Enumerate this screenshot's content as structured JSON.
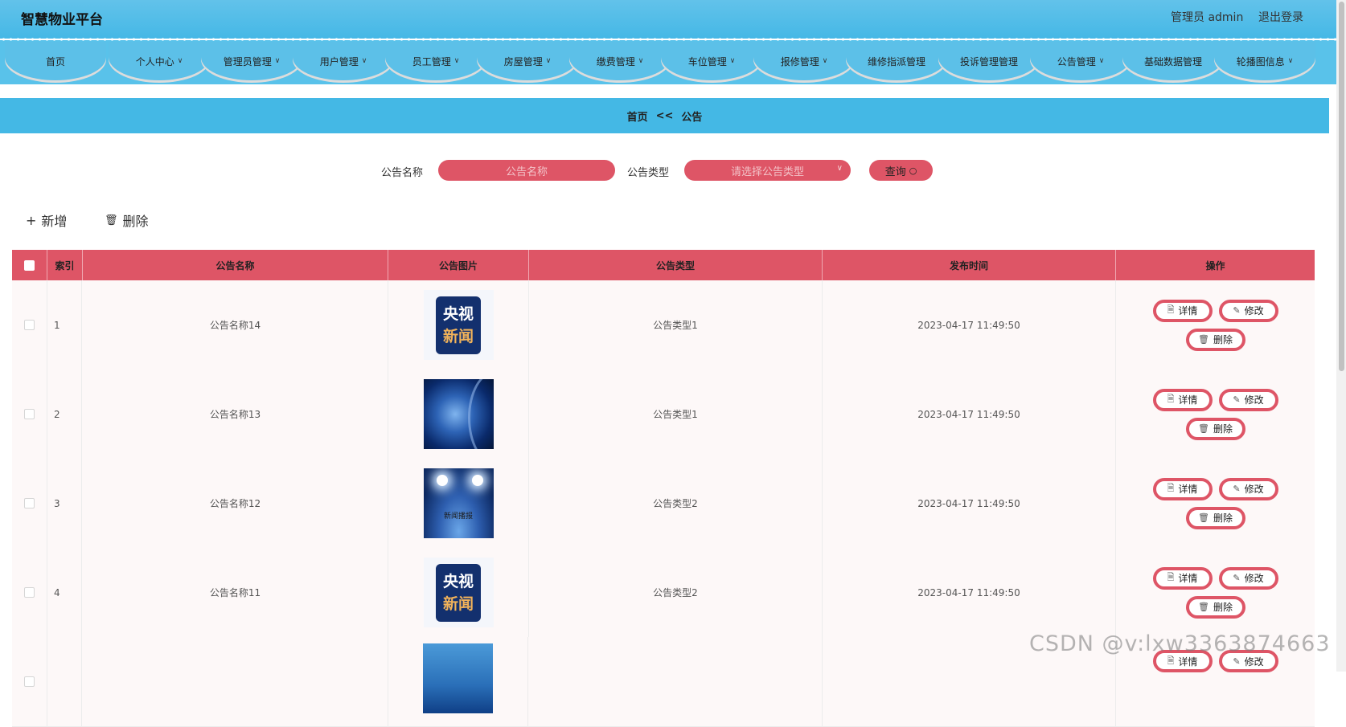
{
  "header": {
    "brand": "智慧物业平台",
    "admin_label": "管理员 admin",
    "logout_label": "退出登录"
  },
  "nav": [
    {
      "label": "首页",
      "dropdown": false
    },
    {
      "label": "个人中心",
      "dropdown": true
    },
    {
      "label": "管理员管理",
      "dropdown": true
    },
    {
      "label": "用户管理",
      "dropdown": true
    },
    {
      "label": "员工管理",
      "dropdown": true
    },
    {
      "label": "房屋管理",
      "dropdown": true
    },
    {
      "label": "缴费管理",
      "dropdown": true
    },
    {
      "label": "车位管理",
      "dropdown": true
    },
    {
      "label": "报修管理",
      "dropdown": true
    },
    {
      "label": "维修指派管理",
      "dropdown": false
    },
    {
      "label": "投诉管理管理",
      "dropdown": false
    },
    {
      "label": "公告管理",
      "dropdown": true
    },
    {
      "label": "基础数据管理",
      "dropdown": false
    },
    {
      "label": "轮播图信息",
      "dropdown": true
    }
  ],
  "breadcrumb": {
    "home": "首页",
    "sep": "<<",
    "current": "公告"
  },
  "search": {
    "name_label": "公告名称",
    "name_placeholder": "公告名称",
    "type_label": "公告类型",
    "type_placeholder": "请选择公告类型",
    "query_label": "查询"
  },
  "actions": {
    "add_label": "新增",
    "delete_label": "删除"
  },
  "table": {
    "columns": [
      "索引",
      "公告名称",
      "公告图片",
      "公告类型",
      "发布时间",
      "操作"
    ],
    "rows": [
      {
        "index": "1",
        "name": "公告名称14",
        "image": "cctv-news-logo",
        "type": "公告类型1",
        "time": "2023-04-17 11:49:50"
      },
      {
        "index": "2",
        "name": "公告名称13",
        "image": "globe-news",
        "type": "公告类型1",
        "time": "2023-04-17 11:49:50"
      },
      {
        "index": "3",
        "name": "公告名称12",
        "image": "news-stage",
        "type": "公告类型2",
        "time": "2023-04-17 11:49:50"
      },
      {
        "index": "4",
        "name": "公告名称11",
        "image": "cctv-news-logo",
        "type": "公告类型2",
        "time": "2023-04-17 11:49:50"
      },
      {
        "index": "",
        "name": "",
        "image": "sea-news",
        "type": "",
        "time": ""
      }
    ],
    "row_buttons": {
      "detail": "详情",
      "edit": "修改",
      "delete": "删除"
    }
  },
  "image_text": {
    "cctv_line1": "央视",
    "cctv_line2": "新闻",
    "stage": "新闻播报"
  },
  "watermark": "CSDN @v:lxw3363874663",
  "colors": {
    "accent": "#de5566",
    "header": "#45b8e6"
  }
}
